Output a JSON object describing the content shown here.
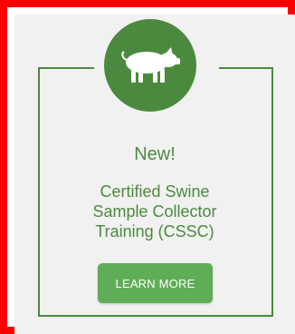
{
  "card": {
    "icon": "pig-icon",
    "title": "New!",
    "description_lines": [
      "Certified Swine",
      "Sample Collector",
      "Training (CSSC)"
    ],
    "button_label": "LEARN MORE"
  },
  "colors": {
    "outer_border": "#ff0000",
    "card_background": "#f1f1f1",
    "brand_green": "#4b8a3e",
    "button_green": "#5fad56",
    "button_text": "#ffffff"
  }
}
